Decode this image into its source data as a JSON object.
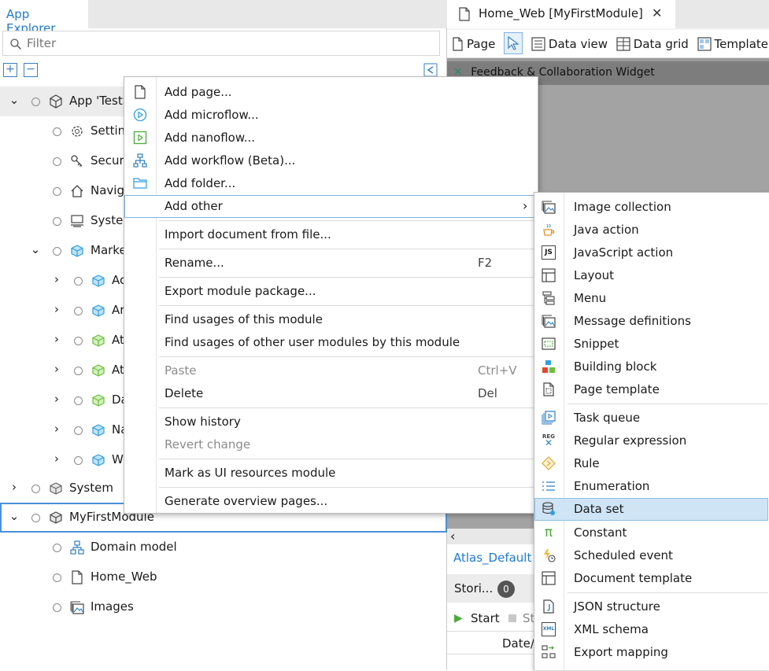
{
  "app_explorer": {
    "tab_label": "App Explorer",
    "filter_placeholder": "Filter",
    "expand_all": "+",
    "collapse_all": "−",
    "tree": [
      {
        "label": "App 'TestS",
        "chevron": "⌄"
      },
      {
        "label": "Settin"
      },
      {
        "label": "Securi"
      },
      {
        "label": "Navig"
      },
      {
        "label": "Syster"
      },
      {
        "label": "Marke",
        "chevron": "⌄"
      },
      {
        "label": "Ac",
        "chevron": "›"
      },
      {
        "label": "Ar",
        "chevron": "›"
      },
      {
        "label": "At",
        "chevron": "›"
      },
      {
        "label": "At",
        "chevron": "›"
      },
      {
        "label": "Da",
        "chevron": "›"
      },
      {
        "label": "Na",
        "chevron": "›"
      },
      {
        "label": "W",
        "chevron": "›"
      },
      {
        "label": "System",
        "chevron": "›"
      },
      {
        "label": "MyFirstModule",
        "chevron": "⌄"
      },
      {
        "label": "Domain model"
      },
      {
        "label": "Home_Web"
      },
      {
        "label": "Images"
      }
    ]
  },
  "editor": {
    "doc_tab": "Home_Web [MyFirstModule]",
    "close_glyph": "✕",
    "toolbar": {
      "page": "Page",
      "data_view": "Data view",
      "data_grid": "Data grid",
      "template": "Template g"
    },
    "widget_title": "Feedback & Collaboration Widget",
    "layout_link": "Atlas_Default",
    "stories_label": "Stori...",
    "stories_count": "0",
    "start_label": "Start",
    "stop_label": "St",
    "date_col": "Date/",
    "scroll_left": "‹"
  },
  "context_menu": {
    "items": [
      {
        "label": "Add page...",
        "icon": "page-icon"
      },
      {
        "label": "Add microflow...",
        "icon": "microflow-icon"
      },
      {
        "label": "Add nanoflow...",
        "icon": "nanoflow-icon"
      },
      {
        "label": "Add workflow (Beta)...",
        "icon": "workflow-icon"
      },
      {
        "label": "Add folder...",
        "icon": "folder-icon"
      },
      {
        "label": "Add other",
        "arrow": "›"
      },
      {
        "label": "Import document from file..."
      },
      {
        "label": "Rename...",
        "shortcut": "F2"
      },
      {
        "label": "Export module package..."
      },
      {
        "label": "Find usages of this module"
      },
      {
        "label": "Find usages of other user modules by this module"
      },
      {
        "label": "Paste",
        "shortcut": "Ctrl+V"
      },
      {
        "label": "Delete",
        "shortcut": "Del"
      },
      {
        "label": "Show history"
      },
      {
        "label": "Revert change"
      },
      {
        "label": "Mark as UI resources module"
      },
      {
        "label": "Generate overview pages..."
      }
    ]
  },
  "submenu": {
    "items": [
      {
        "label": "Image collection"
      },
      {
        "label": "Java action"
      },
      {
        "label": "JavaScript action",
        "icon_text": "JS"
      },
      {
        "label": "Layout"
      },
      {
        "label": "Menu"
      },
      {
        "label": "Message definitions"
      },
      {
        "label": "Snippet"
      },
      {
        "label": "Building block"
      },
      {
        "label": "Page template"
      },
      {
        "label": "Task queue"
      },
      {
        "label": "Regular expression",
        "icon_text": "REG"
      },
      {
        "label": "Rule"
      },
      {
        "label": "Enumeration"
      },
      {
        "label": "Data set"
      },
      {
        "label": "Constant",
        "icon_text": "π"
      },
      {
        "label": "Scheduled event"
      },
      {
        "label": "Document template"
      },
      {
        "label": "JSON structure"
      },
      {
        "label": "XML schema",
        "icon_text": "XML"
      },
      {
        "label": "Export mapping"
      }
    ]
  },
  "colors": {
    "accent": "#1f7ad1",
    "menu_highlight": "#cfe4f5",
    "module_green": "#6cbf3a",
    "module_blue": "#2f9fe0"
  }
}
